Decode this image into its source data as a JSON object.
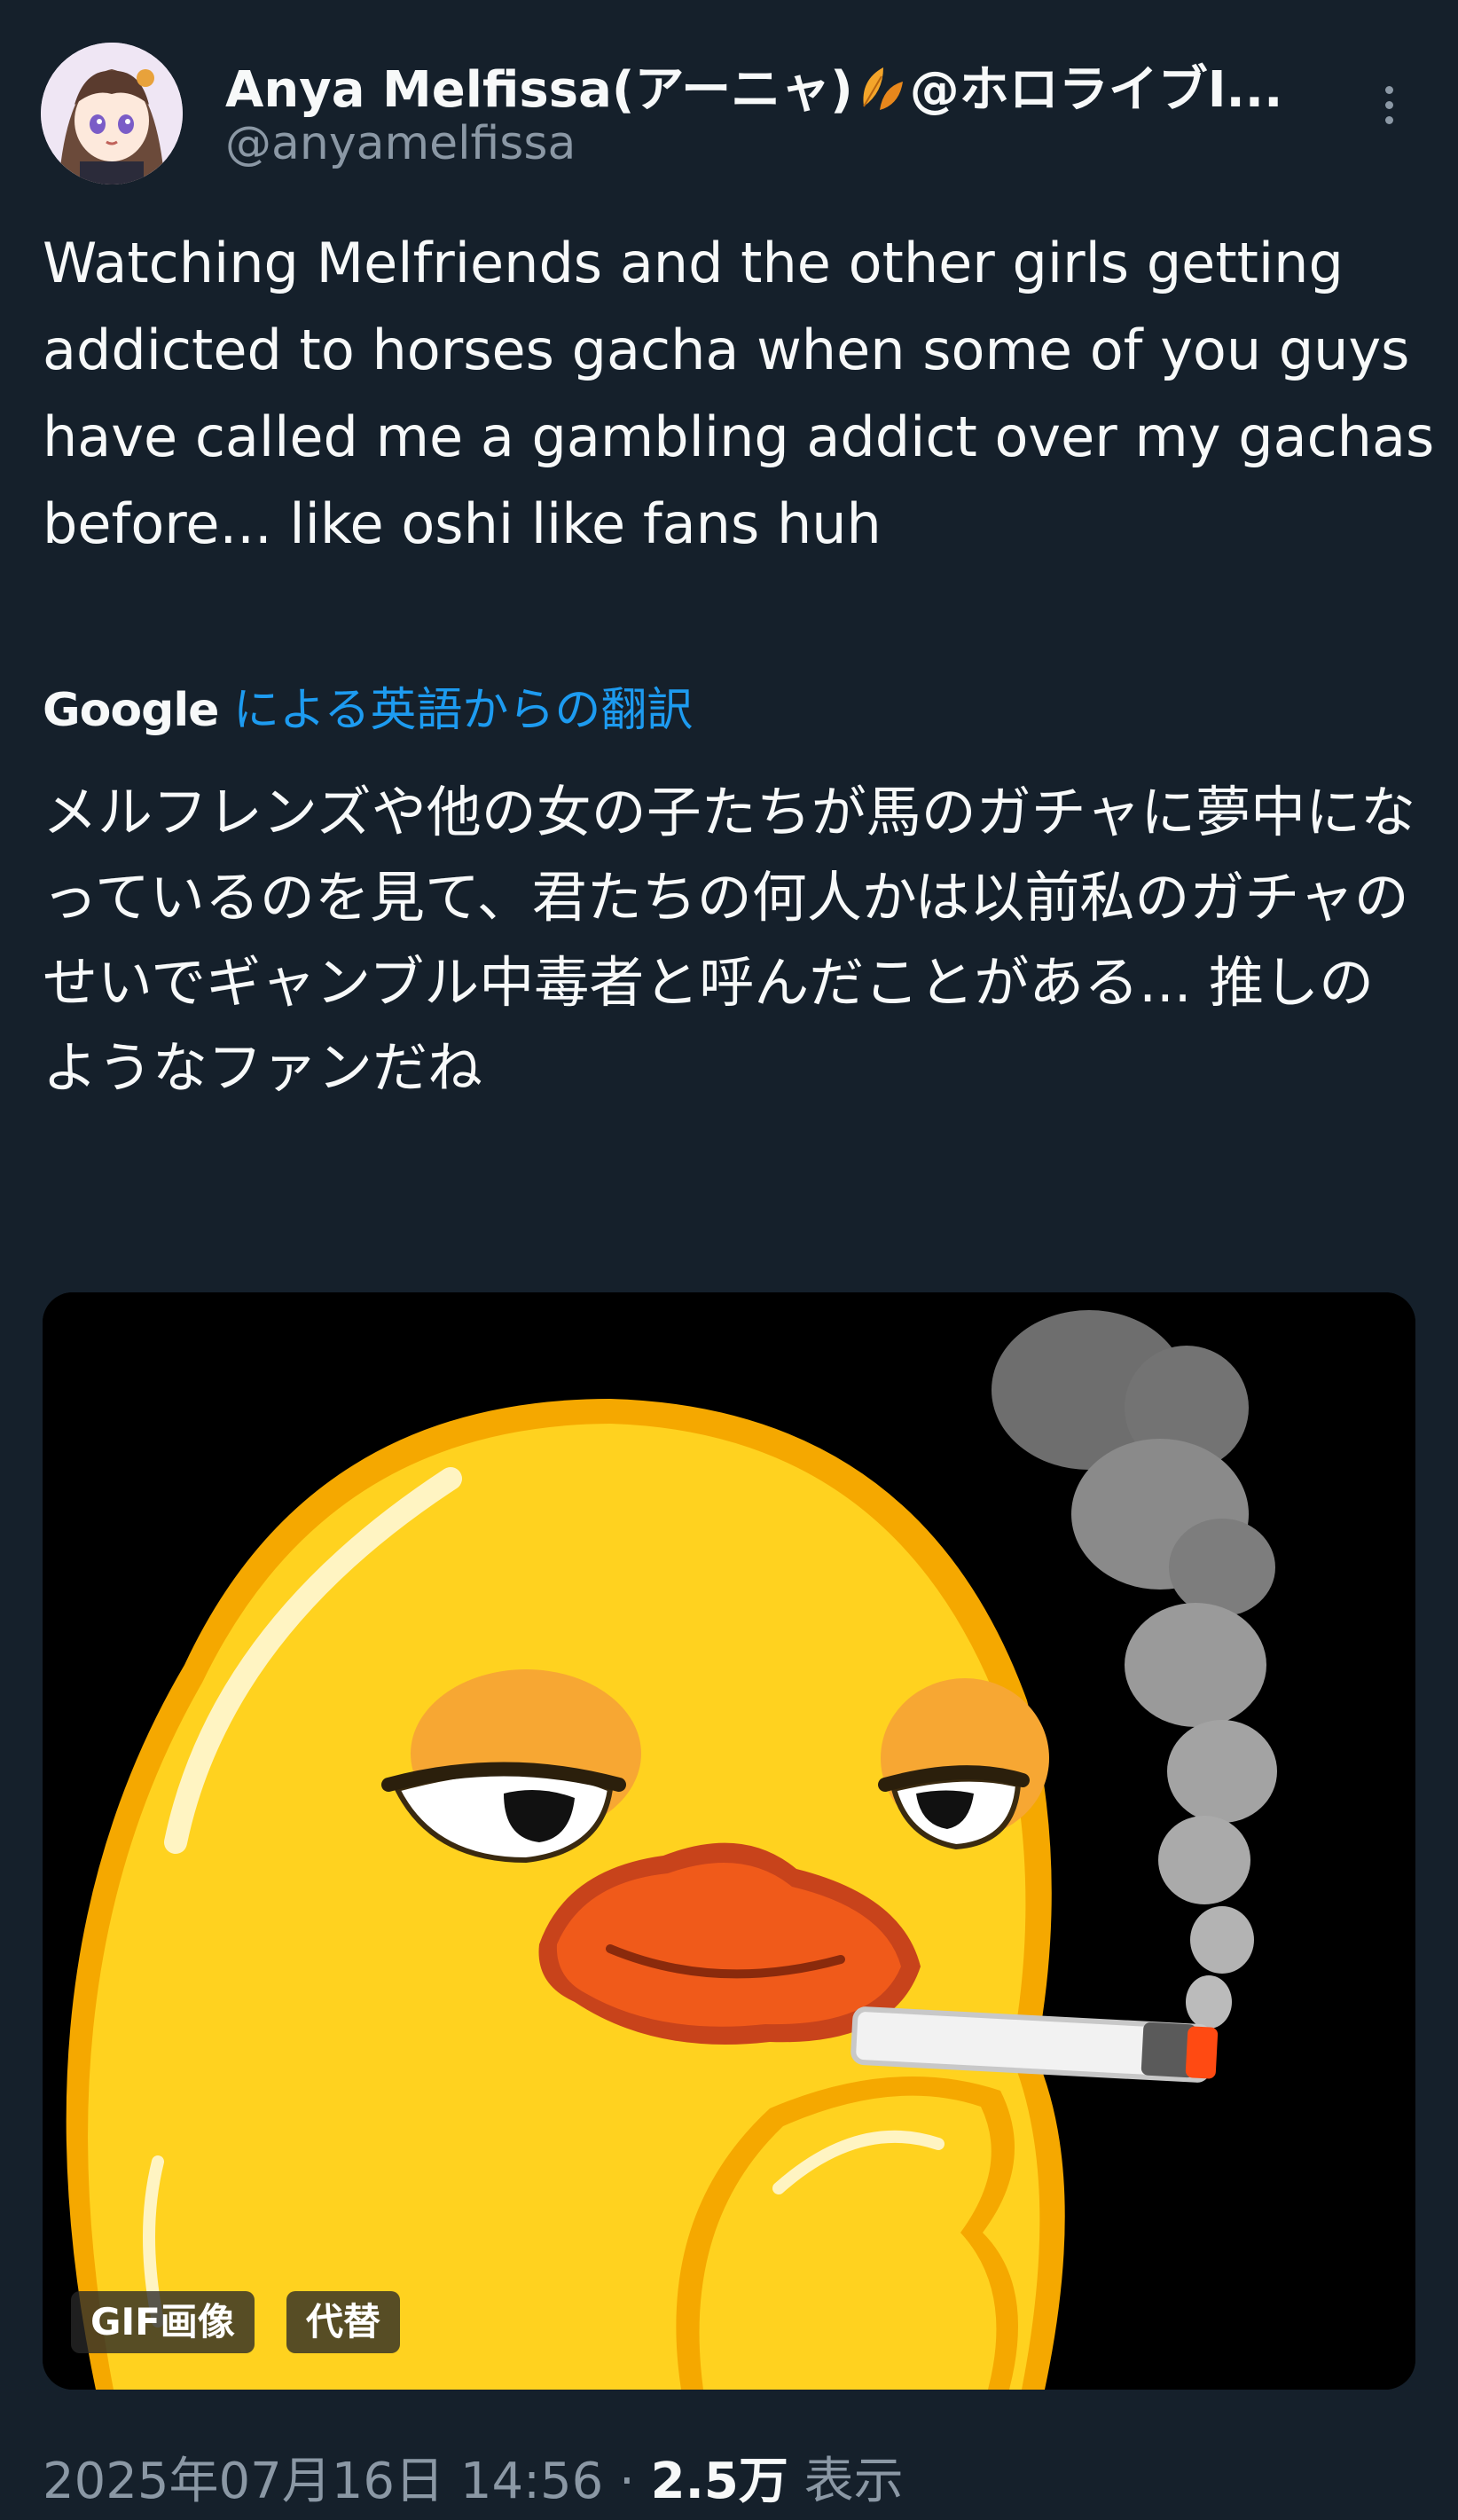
{
  "tweet": {
    "display_name": "Anya Melfissa(アーニャ)",
    "name_suffix": "@ホロライブI...",
    "handle": "@anyamelfissa",
    "text": "Watching Melfriends and the other girls getting addicted to horses gacha when some of you guys have called me a gambling addict over my gachas before... like oshi like fans huh",
    "translation": {
      "provider": "Google",
      "label": "による英語からの翻訳",
      "text": "メルフレンズや他の女の子たちが馬のガチャに夢中になっているのを見て、君たちの何人かは以前私のガチャのせいでギャンブル中毒者と呼んだことがある... 推しのようなファンだね"
    },
    "media": {
      "gif_badge": "GIF画像",
      "alt_badge": "代替"
    },
    "meta": {
      "timestamp": "2025年07月16日 14:56",
      "separator": "·",
      "views_count": "2.5万",
      "views_label": "表示"
    }
  },
  "icons": {
    "leaf": "orange-leaf-emoji",
    "more": "vertical-ellipsis-icon"
  },
  "colors": {
    "background": "#15202b",
    "text": "#f7f9f9",
    "secondary": "#8b98a5",
    "link": "#1d9bf0",
    "duck": "#ffd21f",
    "beak": "#f05a1a"
  }
}
